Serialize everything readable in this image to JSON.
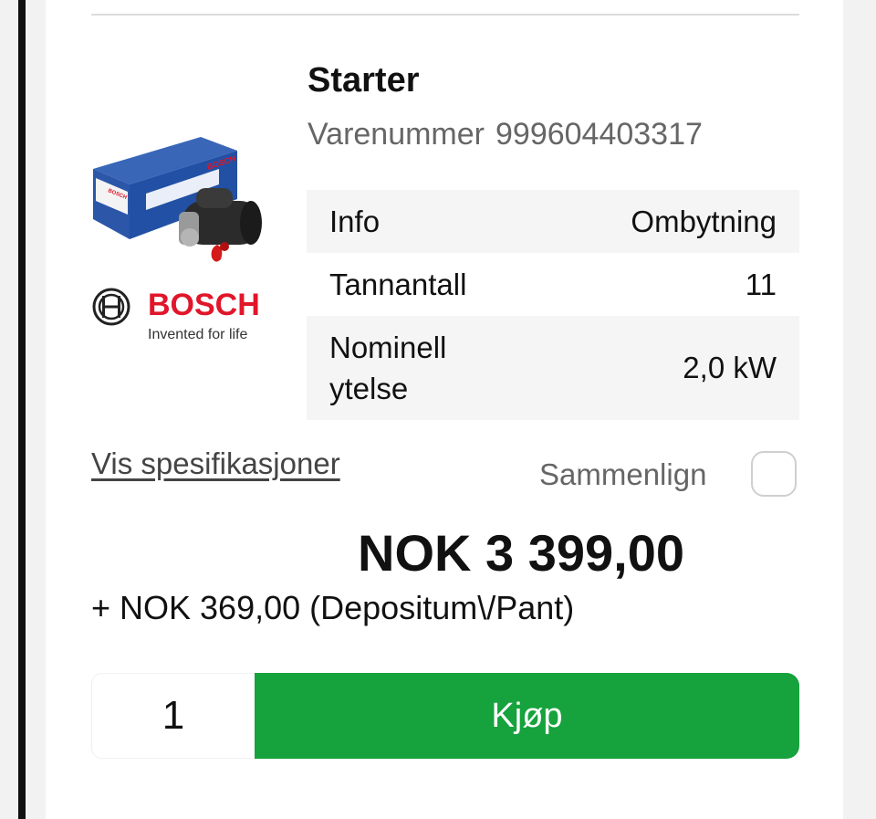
{
  "product": {
    "title": "Starter",
    "sku_label": "Varenummer",
    "sku_value": "999604403317",
    "image_icon": "starter-motor-product-image"
  },
  "brand": {
    "name": "BOSCH",
    "tagline": "Invented for life",
    "color": "#e0162b",
    "logo_icon": "bosch-logo-icon"
  },
  "specs": [
    {
      "key": "Info",
      "value": "Ombytning"
    },
    {
      "key": "Tannantall",
      "value": "11"
    },
    {
      "key": "Nominell ytelse",
      "value": "2,0 kW"
    }
  ],
  "links": {
    "specifications": "Vis spesifikasjoner"
  },
  "compare": {
    "label": "Sammenlign",
    "checked": false
  },
  "pricing": {
    "price": "NOK 3 399,00",
    "deposit": "+ NOK 369,00 (Depositum\\/Pant)"
  },
  "purchase": {
    "quantity": "1",
    "buy_label": "Kjøp",
    "button_color": "#16a23c"
  }
}
